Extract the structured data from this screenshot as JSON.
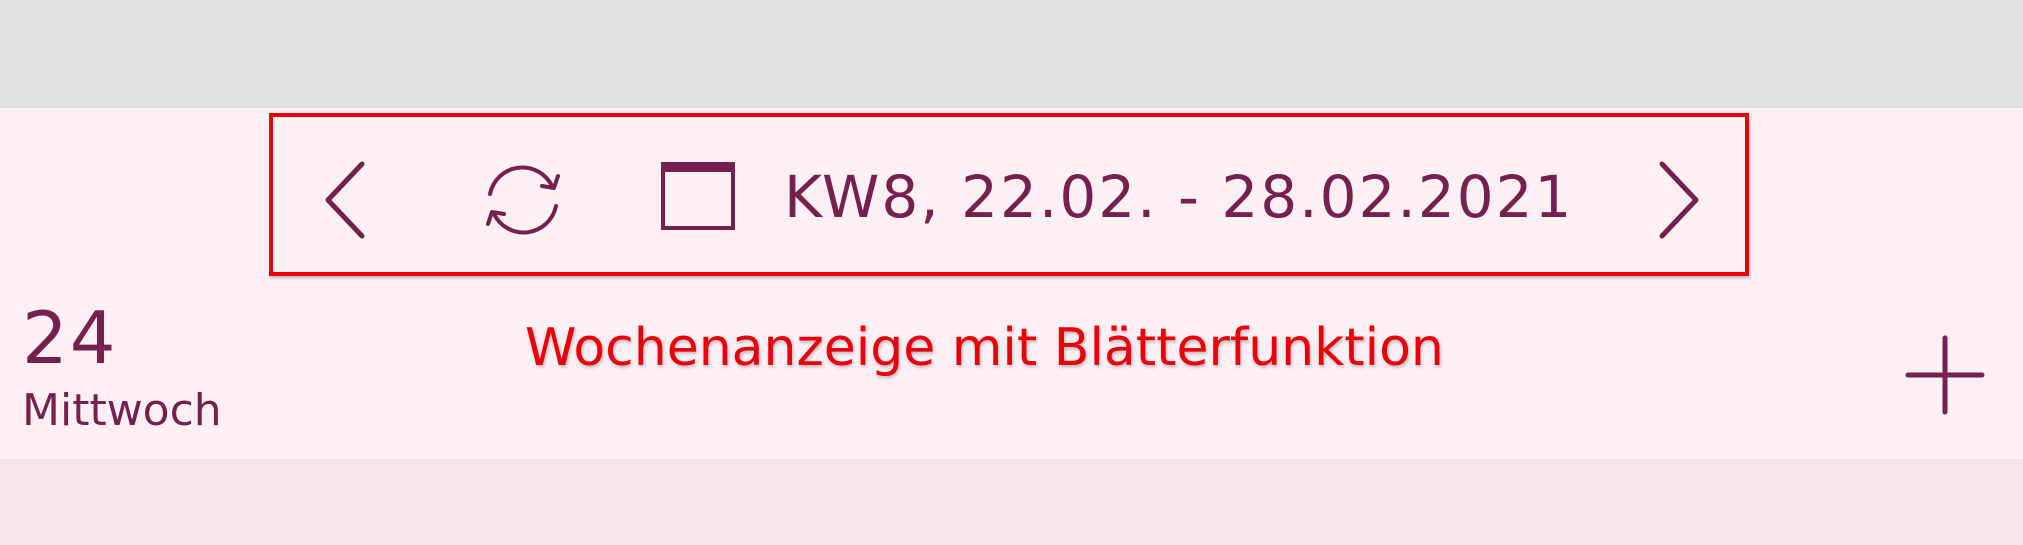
{
  "week_nav": {
    "prev_icon": "chevron-left-icon",
    "refresh_icon": "refresh-icon",
    "calendar_icon": "calendar-icon",
    "label": "KW8, 22.02. - 28.02.2021",
    "next_icon": "chevron-right-icon"
  },
  "day": {
    "number": "24",
    "name": "Mittwoch"
  },
  "annotation": {
    "text": "Wochenanzeige mit Blätterfunktion"
  },
  "add_icon": "plus-icon",
  "colors": {
    "accent": "#74214f",
    "highlight": "#e8000b",
    "header_background": "#fdf0f5",
    "page_background": "#f6e2ea",
    "status_strip": "#e0e0e0"
  }
}
